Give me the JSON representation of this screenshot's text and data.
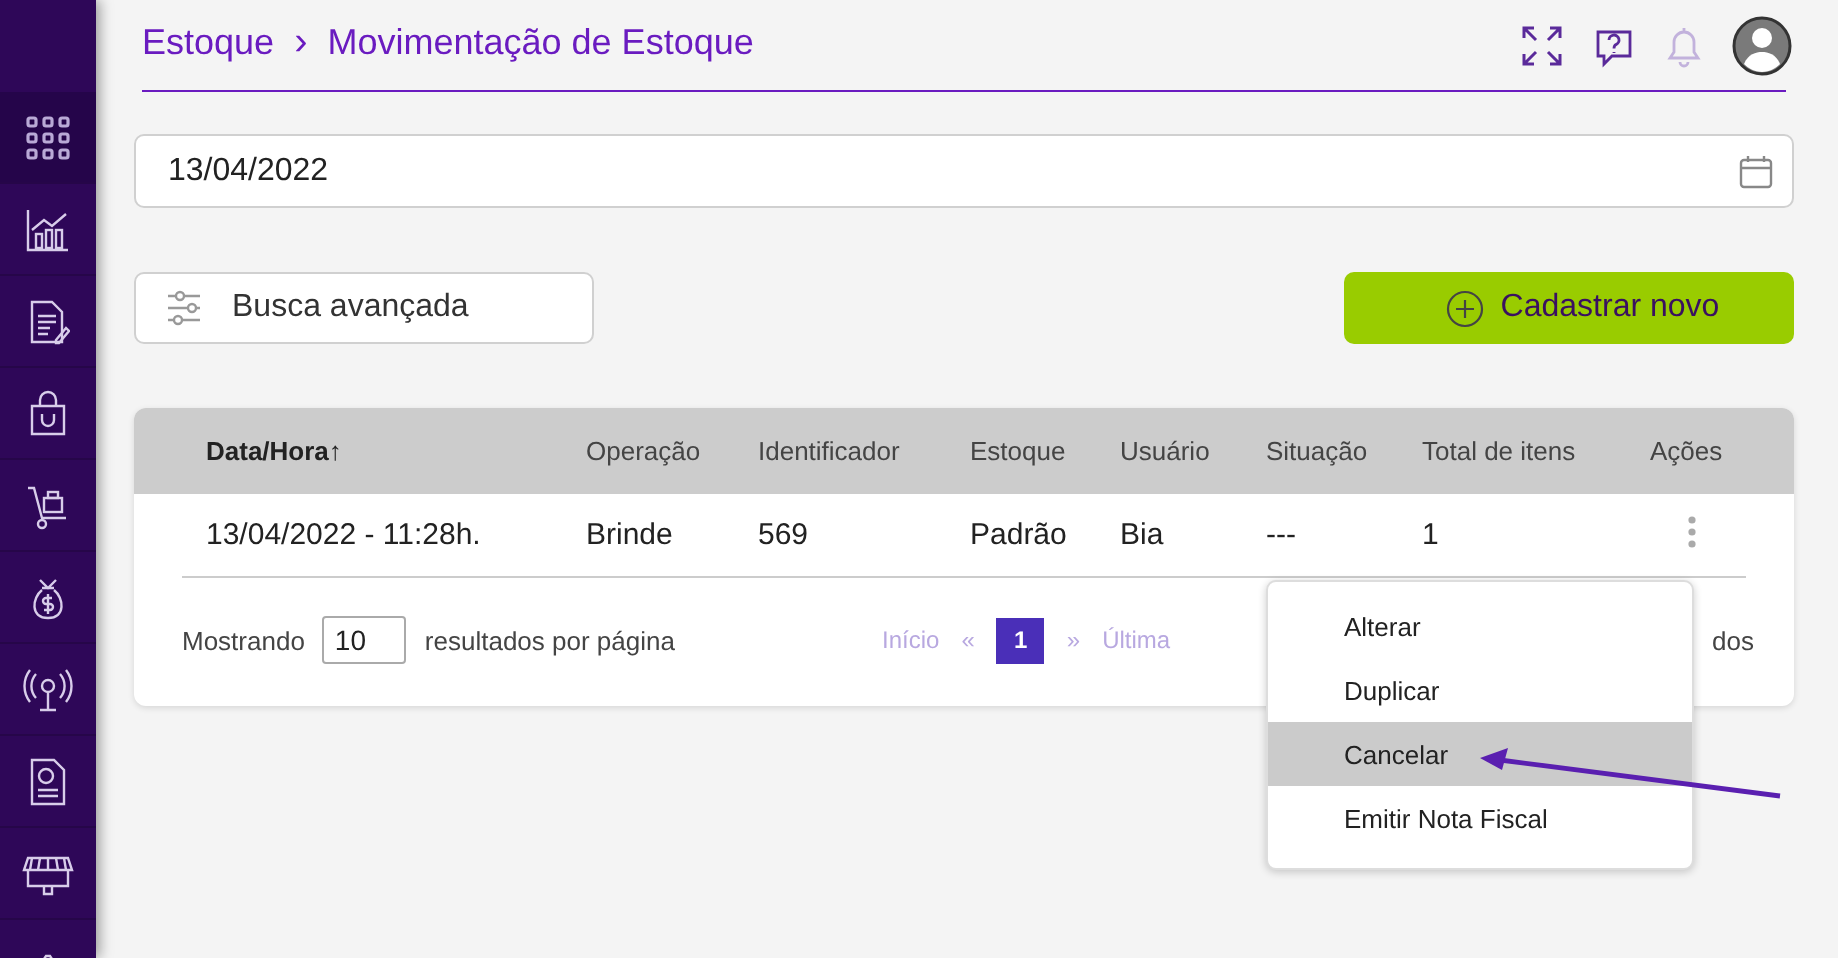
{
  "sidebar": {
    "items": [
      {
        "selected": true
      },
      {
        "selected": false
      },
      {
        "selected": false
      },
      {
        "selected": false
      },
      {
        "selected": false
      },
      {
        "selected": false
      },
      {
        "selected": false
      },
      {
        "selected": false
      },
      {
        "selected": false
      },
      {
        "selected": false
      }
    ]
  },
  "header": {
    "breadcrumb": [
      "Estoque",
      "Movimentação de Estoque"
    ],
    "separator": "›"
  },
  "date_field": {
    "value": "13/04/2022"
  },
  "advanced_search": {
    "label": "Busca avançada"
  },
  "create_button": {
    "label": "Cadastrar novo"
  },
  "table": {
    "columns": [
      {
        "label": "Data/Hora",
        "sorted": true
      },
      {
        "label": "Operação",
        "sorted": false
      },
      {
        "label": "Identificador",
        "sorted": false
      },
      {
        "label": "Estoque",
        "sorted": false
      },
      {
        "label": "Usuário",
        "sorted": false
      },
      {
        "label": "Situação",
        "sorted": false
      },
      {
        "label": "Total de itens",
        "sorted": false
      },
      {
        "label": "Ações",
        "sorted": false
      }
    ],
    "sort_indicator": "↑",
    "rows": [
      {
        "cells": [
          "13/04/2022 - 11:28h.",
          "Brinde",
          "569",
          "Padrão",
          "Bia",
          "---",
          "1"
        ]
      }
    ]
  },
  "footer": {
    "showing": "Mostrando",
    "page_size": "10",
    "per_page": "resultados por página",
    "first": "Início",
    "prev": "«",
    "pages": [
      {
        "label": "1",
        "selected": true
      }
    ],
    "next": "»",
    "last": "Última",
    "results_tail": "dos"
  },
  "action_menu": {
    "items": [
      {
        "label": "Alterar",
        "selected": false
      },
      {
        "label": "Duplicar",
        "selected": false
      },
      {
        "label": "Cancelar",
        "selected": true
      },
      {
        "label": "Emitir Nota Fiscal",
        "selected": false
      }
    ]
  }
}
